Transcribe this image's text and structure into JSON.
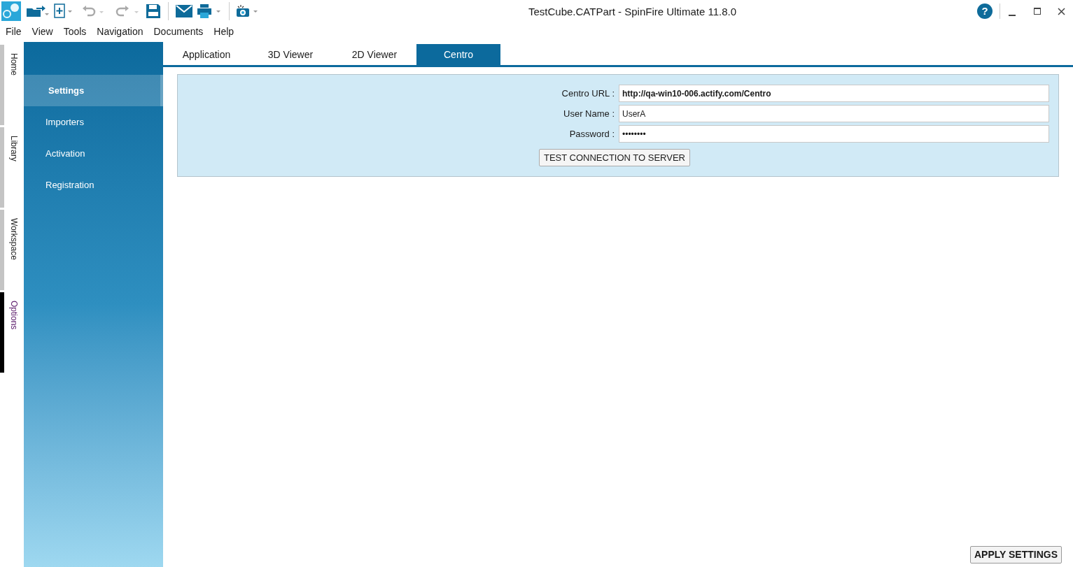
{
  "window": {
    "title": "TestCube.CATPart - SpinFire Ultimate 11.8.0",
    "help_glyph": "?"
  },
  "menu": [
    "File",
    "View",
    "Tools",
    "Navigation",
    "Documents",
    "Help"
  ],
  "side_tabs": [
    {
      "label": "Home",
      "selected": false
    },
    {
      "label": "Library",
      "selected": false
    },
    {
      "label": "Workspace",
      "selected": false
    },
    {
      "label": "Options",
      "selected": true
    }
  ],
  "sidebar": {
    "items": [
      {
        "label": "Settings",
        "selected": true
      },
      {
        "label": "Importers",
        "selected": false
      },
      {
        "label": "Activation",
        "selected": false
      },
      {
        "label": "Registration",
        "selected": false
      }
    ]
  },
  "tabs": [
    {
      "label": "Application",
      "selected": false
    },
    {
      "label": "3D Viewer",
      "selected": false
    },
    {
      "label": "2D Viewer",
      "selected": false
    },
    {
      "label": "Centro",
      "selected": true
    }
  ],
  "form": {
    "fields": [
      {
        "label": "Centro URL :",
        "value": "http://qa-win10-006.actify.com/Centro",
        "bold": true
      },
      {
        "label": "User Name :",
        "value": "UserA",
        "bold": false
      },
      {
        "label": "Password :",
        "value": "••••••••",
        "bold": false
      }
    ],
    "test_button": "TEST CONNECTION TO SERVER"
  },
  "apply_button": "APPLY SETTINGS"
}
